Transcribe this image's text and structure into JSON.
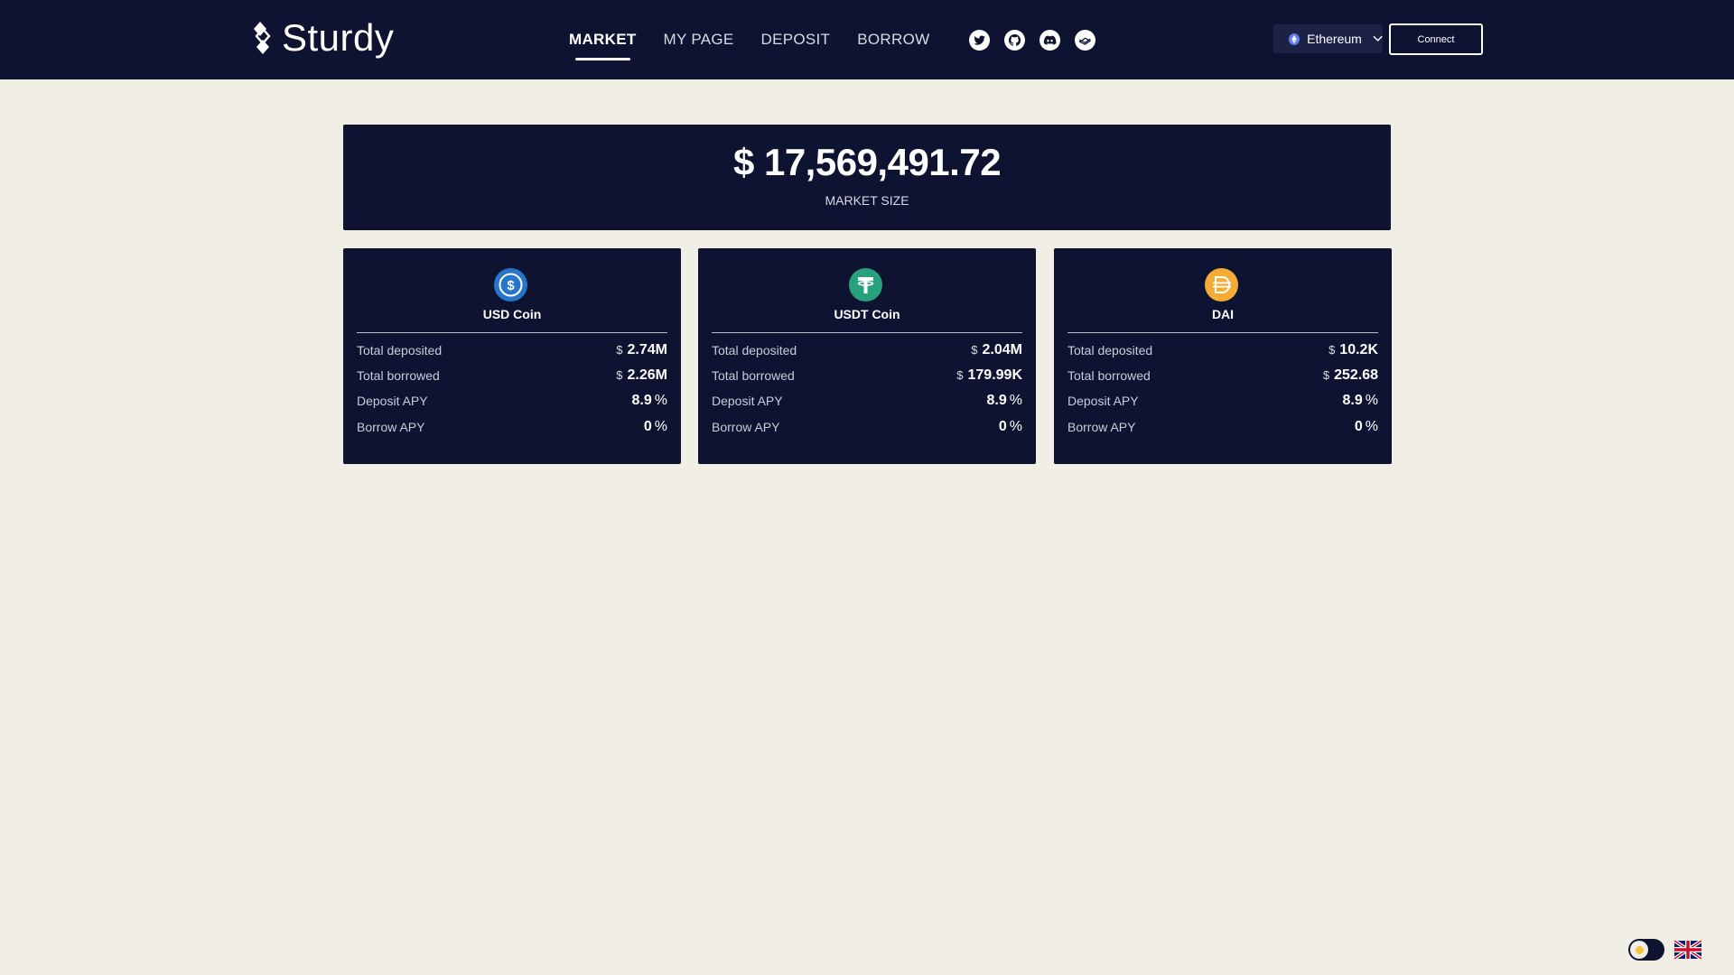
{
  "header": {
    "logo_text": "Sturdy",
    "nav": [
      {
        "label": "MARKET",
        "active": true
      },
      {
        "label": "MY PAGE",
        "active": false
      },
      {
        "label": "DEPOSIT",
        "active": false
      },
      {
        "label": "BORROW",
        "active": false
      }
    ],
    "socials": [
      "twitter-icon",
      "github-icon",
      "discord-icon",
      "gitbook-icon"
    ],
    "network_label": "Ethereum",
    "connect_label": "Connect"
  },
  "market": {
    "value": "$ 17,569,491.72",
    "label": "MARKET SIZE"
  },
  "cards": [
    {
      "name": "USD Coin",
      "icon": "usdc-icon",
      "icon_color": "#2775ca",
      "deposited": "2.74M",
      "borrowed": "2.26M",
      "deposit_apy": "8.9",
      "borrow_apy": "0"
    },
    {
      "name": "USDT Coin",
      "icon": "usdt-icon",
      "icon_color": "#26a17b",
      "deposited": "2.04M",
      "borrowed": "179.99K",
      "deposit_apy": "8.9",
      "borrow_apy": "0"
    },
    {
      "name": "DAI",
      "icon": "dai-icon",
      "icon_color": "#f5ac37",
      "deposited": "10.2K",
      "borrowed": "252.68",
      "deposit_apy": "8.9",
      "borrow_apy": "0"
    }
  ],
  "labels": {
    "total_deposited": "Total deposited",
    "total_borrowed": "Total borrowed",
    "deposit_apy": "Deposit APY",
    "borrow_apy": "Borrow APY",
    "currency": "$",
    "percent": "%"
  },
  "colors": {
    "background": "#f1eee6",
    "panel": "#0d1331",
    "text": "#ffffff"
  }
}
